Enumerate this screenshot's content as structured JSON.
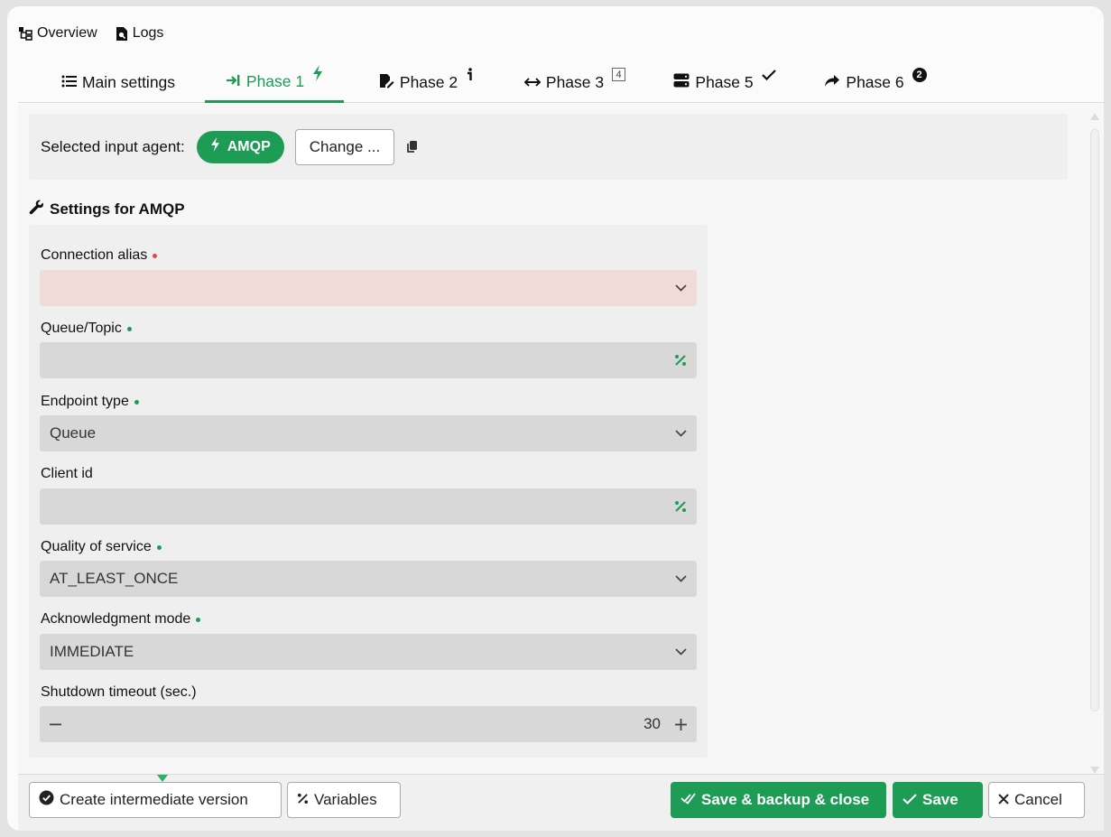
{
  "top_links": [
    {
      "label": "Overview",
      "icon": "sitemap-icon"
    },
    {
      "label": "Logs",
      "icon": "file-search-icon"
    }
  ],
  "tabs": [
    {
      "label": "Main settings",
      "icon": "list-icon",
      "active": false
    },
    {
      "label": "Phase 1",
      "icon": "arrow-to-right-icon",
      "badge_icon": "bolt-icon",
      "active": true
    },
    {
      "label": "Phase 2",
      "icon": "file-pen-icon",
      "badge_icon": "info-icon",
      "active": false
    },
    {
      "label": "Phase 3",
      "icon": "arrows-horizontal-icon",
      "badge": "4",
      "active": false
    },
    {
      "label": "Phase 5",
      "icon": "server-icon",
      "badge_icon": "check-icon",
      "active": false
    },
    {
      "label": "Phase 6",
      "icon": "share-icon",
      "badge": "2",
      "active": false
    }
  ],
  "agent": {
    "label": "Selected input agent:",
    "name": "AMQP",
    "change_label": "Change ..."
  },
  "settings_title": "Settings for AMQP",
  "fields": {
    "connection_alias": {
      "label": "Connection alias",
      "value": ""
    },
    "queue_topic": {
      "label": "Queue/Topic",
      "value": ""
    },
    "endpoint_type": {
      "label": "Endpoint type",
      "value": "Queue"
    },
    "client_id": {
      "label": "Client id",
      "value": ""
    },
    "quality_of_service": {
      "label": "Quality of service",
      "value": "AT_LEAST_ONCE"
    },
    "acknowledgment_mode": {
      "label": "Acknowledgment mode",
      "value": "IMMEDIATE"
    },
    "shutdown_timeout": {
      "label": "Shutdown timeout (sec.)",
      "value": "30"
    }
  },
  "footer": {
    "intermediate_label": "Create intermediate version",
    "variables_label": "Variables",
    "save_backup_close_label": "Save & backup & close",
    "save_label": "Save",
    "cancel_label": "Cancel"
  },
  "colors": {
    "accent": "#1e9b55",
    "error_field": "#f1dbd9",
    "required_dot": "#e04646"
  }
}
